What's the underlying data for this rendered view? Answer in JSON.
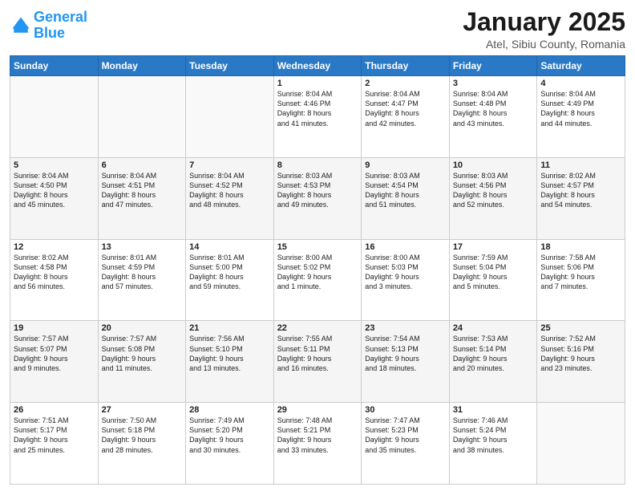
{
  "logo": {
    "line1": "General",
    "line2": "Blue"
  },
  "title": "January 2025",
  "subtitle": "Atel, Sibiu County, Romania",
  "weekdays": [
    "Sunday",
    "Monday",
    "Tuesday",
    "Wednesday",
    "Thursday",
    "Friday",
    "Saturday"
  ],
  "weeks": [
    [
      {
        "day": "",
        "info": ""
      },
      {
        "day": "",
        "info": ""
      },
      {
        "day": "",
        "info": ""
      },
      {
        "day": "1",
        "info": "Sunrise: 8:04 AM\nSunset: 4:46 PM\nDaylight: 8 hours\nand 41 minutes."
      },
      {
        "day": "2",
        "info": "Sunrise: 8:04 AM\nSunset: 4:47 PM\nDaylight: 8 hours\nand 42 minutes."
      },
      {
        "day": "3",
        "info": "Sunrise: 8:04 AM\nSunset: 4:48 PM\nDaylight: 8 hours\nand 43 minutes."
      },
      {
        "day": "4",
        "info": "Sunrise: 8:04 AM\nSunset: 4:49 PM\nDaylight: 8 hours\nand 44 minutes."
      }
    ],
    [
      {
        "day": "5",
        "info": "Sunrise: 8:04 AM\nSunset: 4:50 PM\nDaylight: 8 hours\nand 45 minutes."
      },
      {
        "day": "6",
        "info": "Sunrise: 8:04 AM\nSunset: 4:51 PM\nDaylight: 8 hours\nand 47 minutes."
      },
      {
        "day": "7",
        "info": "Sunrise: 8:04 AM\nSunset: 4:52 PM\nDaylight: 8 hours\nand 48 minutes."
      },
      {
        "day": "8",
        "info": "Sunrise: 8:03 AM\nSunset: 4:53 PM\nDaylight: 8 hours\nand 49 minutes."
      },
      {
        "day": "9",
        "info": "Sunrise: 8:03 AM\nSunset: 4:54 PM\nDaylight: 8 hours\nand 51 minutes."
      },
      {
        "day": "10",
        "info": "Sunrise: 8:03 AM\nSunset: 4:56 PM\nDaylight: 8 hours\nand 52 minutes."
      },
      {
        "day": "11",
        "info": "Sunrise: 8:02 AM\nSunset: 4:57 PM\nDaylight: 8 hours\nand 54 minutes."
      }
    ],
    [
      {
        "day": "12",
        "info": "Sunrise: 8:02 AM\nSunset: 4:58 PM\nDaylight: 8 hours\nand 56 minutes."
      },
      {
        "day": "13",
        "info": "Sunrise: 8:01 AM\nSunset: 4:59 PM\nDaylight: 8 hours\nand 57 minutes."
      },
      {
        "day": "14",
        "info": "Sunrise: 8:01 AM\nSunset: 5:00 PM\nDaylight: 8 hours\nand 59 minutes."
      },
      {
        "day": "15",
        "info": "Sunrise: 8:00 AM\nSunset: 5:02 PM\nDaylight: 9 hours\nand 1 minute."
      },
      {
        "day": "16",
        "info": "Sunrise: 8:00 AM\nSunset: 5:03 PM\nDaylight: 9 hours\nand 3 minutes."
      },
      {
        "day": "17",
        "info": "Sunrise: 7:59 AM\nSunset: 5:04 PM\nDaylight: 9 hours\nand 5 minutes."
      },
      {
        "day": "18",
        "info": "Sunrise: 7:58 AM\nSunset: 5:06 PM\nDaylight: 9 hours\nand 7 minutes."
      }
    ],
    [
      {
        "day": "19",
        "info": "Sunrise: 7:57 AM\nSunset: 5:07 PM\nDaylight: 9 hours\nand 9 minutes."
      },
      {
        "day": "20",
        "info": "Sunrise: 7:57 AM\nSunset: 5:08 PM\nDaylight: 9 hours\nand 11 minutes."
      },
      {
        "day": "21",
        "info": "Sunrise: 7:56 AM\nSunset: 5:10 PM\nDaylight: 9 hours\nand 13 minutes."
      },
      {
        "day": "22",
        "info": "Sunrise: 7:55 AM\nSunset: 5:11 PM\nDaylight: 9 hours\nand 16 minutes."
      },
      {
        "day": "23",
        "info": "Sunrise: 7:54 AM\nSunset: 5:13 PM\nDaylight: 9 hours\nand 18 minutes."
      },
      {
        "day": "24",
        "info": "Sunrise: 7:53 AM\nSunset: 5:14 PM\nDaylight: 9 hours\nand 20 minutes."
      },
      {
        "day": "25",
        "info": "Sunrise: 7:52 AM\nSunset: 5:16 PM\nDaylight: 9 hours\nand 23 minutes."
      }
    ],
    [
      {
        "day": "26",
        "info": "Sunrise: 7:51 AM\nSunset: 5:17 PM\nDaylight: 9 hours\nand 25 minutes."
      },
      {
        "day": "27",
        "info": "Sunrise: 7:50 AM\nSunset: 5:18 PM\nDaylight: 9 hours\nand 28 minutes."
      },
      {
        "day": "28",
        "info": "Sunrise: 7:49 AM\nSunset: 5:20 PM\nDaylight: 9 hours\nand 30 minutes."
      },
      {
        "day": "29",
        "info": "Sunrise: 7:48 AM\nSunset: 5:21 PM\nDaylight: 9 hours\nand 33 minutes."
      },
      {
        "day": "30",
        "info": "Sunrise: 7:47 AM\nSunset: 5:23 PM\nDaylight: 9 hours\nand 35 minutes."
      },
      {
        "day": "31",
        "info": "Sunrise: 7:46 AM\nSunset: 5:24 PM\nDaylight: 9 hours\nand 38 minutes."
      },
      {
        "day": "",
        "info": ""
      }
    ]
  ]
}
